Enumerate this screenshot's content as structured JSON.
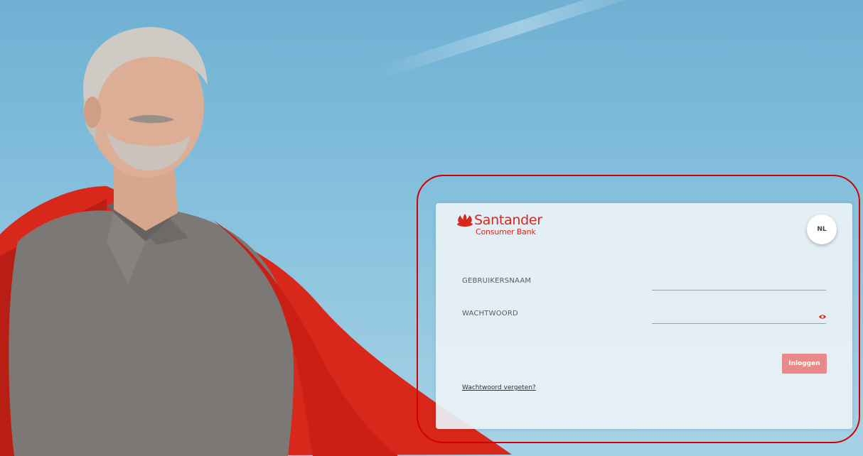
{
  "brand": {
    "name": "Santander",
    "subtitle": "Consumer Bank",
    "color": "#d8281d"
  },
  "language": {
    "current": "NL"
  },
  "form": {
    "username_label": "GEBRUIKERSNAAM",
    "username_value": "",
    "password_label": "WACHTWOORD",
    "password_value": "",
    "submit_label": "Inloggen",
    "forgot_password_label": "Wachtwoord vergeten?"
  },
  "icons": {
    "logo": "santander-flame-icon",
    "password_toggle": "eye-icon"
  },
  "colors": {
    "accent": "#ec0000",
    "button_disabled": "#e98a88",
    "highlight": "#d20000"
  }
}
